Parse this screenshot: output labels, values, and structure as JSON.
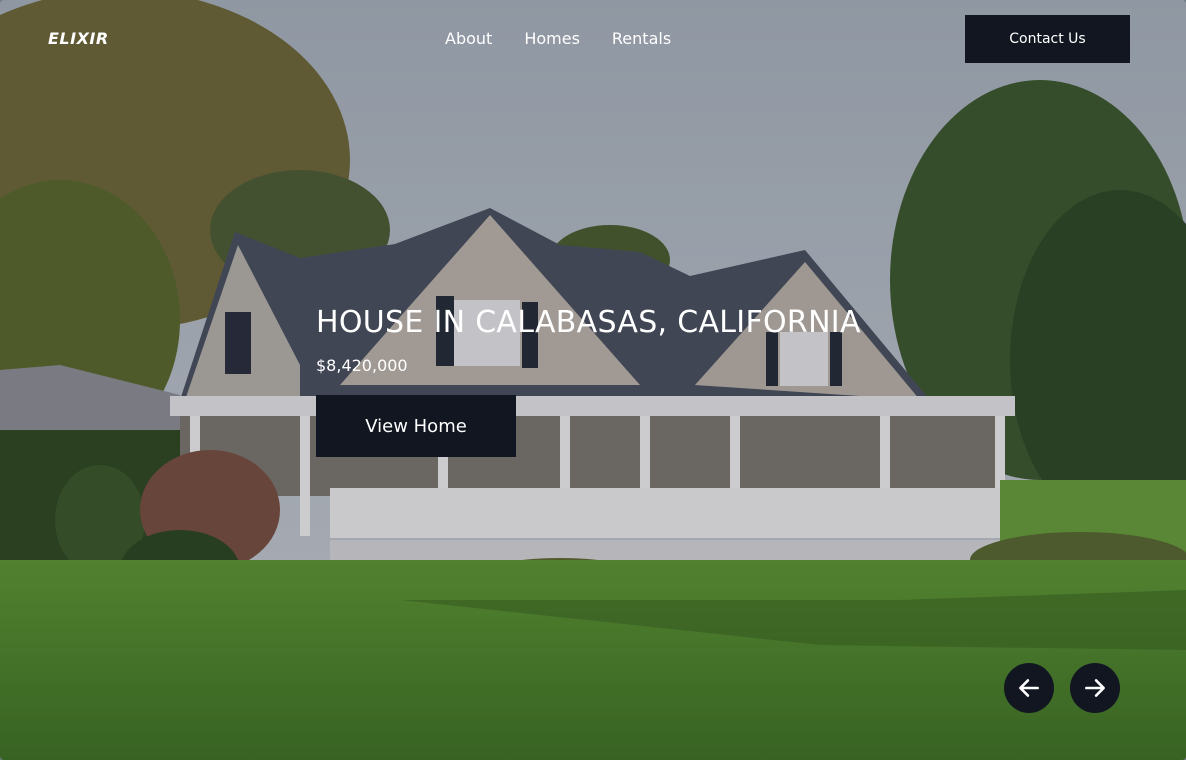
{
  "brand": {
    "logo": "ELIXIR"
  },
  "nav": {
    "items": [
      "About",
      "Homes",
      "Rentals"
    ]
  },
  "header": {
    "contact_label": "Contact Us"
  },
  "hero": {
    "title": "HOUSE IN CALABASAS, CALIFORNIA",
    "price": "$8,420,000",
    "cta_label": "View Home"
  },
  "carousel": {
    "prev_icon": "arrow-left-icon",
    "next_icon": "arrow-right-icon"
  },
  "colors": {
    "dark": "#111621",
    "text": "#ffffff"
  }
}
